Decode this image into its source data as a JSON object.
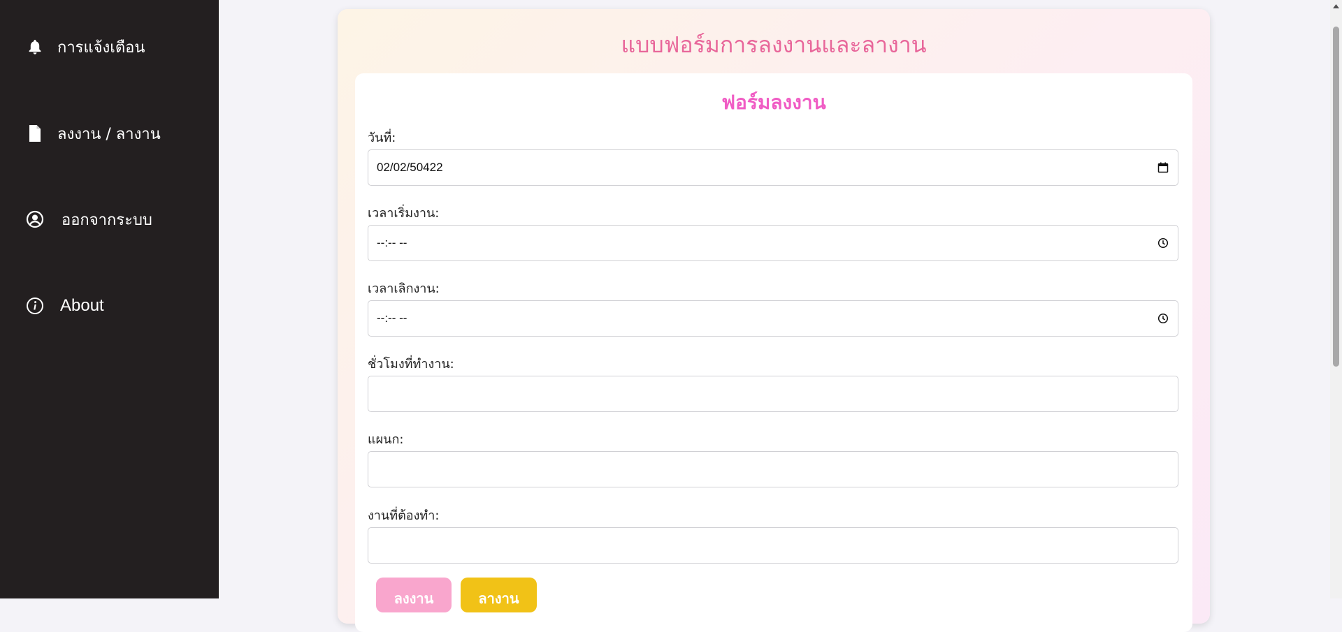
{
  "sidebar": {
    "items": [
      {
        "label": "การแจ้งเตือน",
        "icon": "bell-icon"
      },
      {
        "label": "ลงงาน / ลางาน",
        "icon": "document-icon"
      },
      {
        "label": "ออกจากระบบ",
        "icon": "user-circle-icon"
      },
      {
        "label": "About",
        "icon": "info-icon"
      }
    ]
  },
  "page": {
    "title": "แบบฟอร์มการลงงานและลางาน"
  },
  "form": {
    "title": "ฟอร์มลงงาน",
    "fields": [
      {
        "label": "วันที่:",
        "value": "02/02/50422",
        "icon": "calendar-icon"
      },
      {
        "label": "เวลาเริ่มงาน:",
        "value": "--:-- --",
        "icon": "clock-icon"
      },
      {
        "label": "เวลาเลิกงาน:",
        "value": "--:-- --",
        "icon": "clock-icon"
      },
      {
        "label": "ชั่วโมงที่ทำงาน:",
        "value": ""
      },
      {
        "label": "แผนก:",
        "value": ""
      },
      {
        "label": "งานที่ต้องทำ:",
        "value": ""
      }
    ],
    "buttons": {
      "submit_label": "ลงงาน",
      "leave_label": "ลางาน"
    }
  },
  "colors": {
    "sidebar_bg": "#231f20",
    "page_title": "#e8669a",
    "form_title": "#f05cc4",
    "submit_button": "#f9a6cd",
    "leave_button": "#f1c217"
  }
}
